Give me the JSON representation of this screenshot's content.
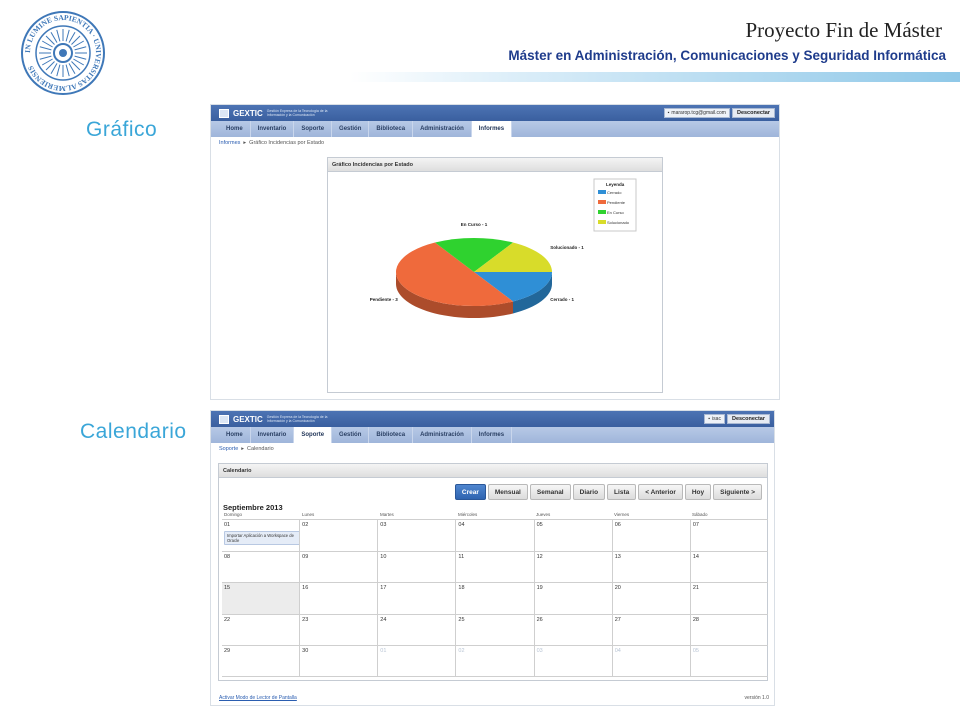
{
  "slide": {
    "title": "Proyecto Fin de Máster",
    "subtitle": "Máster en Administración, Comunicaciones y Seguridad Informática",
    "seal_text": "IN LUMINE SAPIENTIA · UNIVERSITAS ALMERIENSIS",
    "accent_color": "#3aa6d8",
    "brand_color": "#1f3c8c"
  },
  "section_labels": {
    "chart": "Gráfico",
    "calendar": "Calendario"
  },
  "app": {
    "logo_name": "GEXTIC",
    "logo_tagline": "Gestión Express de la Tecnología de la Información y la Comunicación",
    "logout_label": "Desconectar",
    "tabs": [
      "Home",
      "Inventario",
      "Soporte",
      "Gestión",
      "Biblioteca",
      "Administración",
      "Informes"
    ]
  },
  "chart_screen": {
    "user": "mararop.tcg@gmail.com",
    "active_tab": "Informes",
    "breadcrumb": [
      "Informes",
      "Gráfico Incidencias por Estado"
    ],
    "panel_title": "Gráfico Incidencias por Estado"
  },
  "chart_data": {
    "type": "pie",
    "title": "",
    "legend_title": "Leyenda",
    "legend_position": "top-right",
    "three_d": true,
    "slices": [
      {
        "label": "Cerrado",
        "value": 1,
        "color": "#2f8fd6",
        "callout": "Cerrado - 1"
      },
      {
        "label": "Pendiente",
        "value": 3,
        "color": "#ef6a3c",
        "callout": "Pendiente - 3"
      },
      {
        "label": "En Curso",
        "value": 1,
        "color": "#2fd22f",
        "callout": "En Curso - 1"
      },
      {
        "label": "Solucionado",
        "value": 1,
        "color": "#d8dc2a",
        "callout": "Solucionado - 1"
      }
    ]
  },
  "calendar_screen": {
    "user": "isac",
    "active_tab": "Soporte",
    "breadcrumb": [
      "Soporte",
      "Calendario"
    ],
    "panel_title": "Calendario",
    "toolbar": [
      "Crear",
      "Mensual",
      "Semanal",
      "Diario",
      "Lista",
      "< Anterior",
      "Hoy",
      "Siguiente >"
    ],
    "month_label": "Septiembre 2013",
    "weekdays": [
      "Domingo",
      "Lunes",
      "Martes",
      "Miércoles",
      "Jueves",
      "Viernes",
      "Sábado"
    ],
    "weeks": [
      [
        "01",
        "02",
        "03",
        "04",
        "05",
        "06",
        "07"
      ],
      [
        "08",
        "09",
        "10",
        "11",
        "12",
        "13",
        "14"
      ],
      [
        "15",
        "16",
        "17",
        "18",
        "19",
        "20",
        "21"
      ],
      [
        "22",
        "23",
        "24",
        "25",
        "26",
        "27",
        "28"
      ],
      [
        "29",
        "30",
        "01",
        "02",
        "03",
        "04",
        "05"
      ]
    ],
    "event_text": "Importar Aplicación a Workspace de Oracle",
    "footer_link": "Activar Modo de Lector de Pantalla",
    "version": "versión 1.0"
  }
}
